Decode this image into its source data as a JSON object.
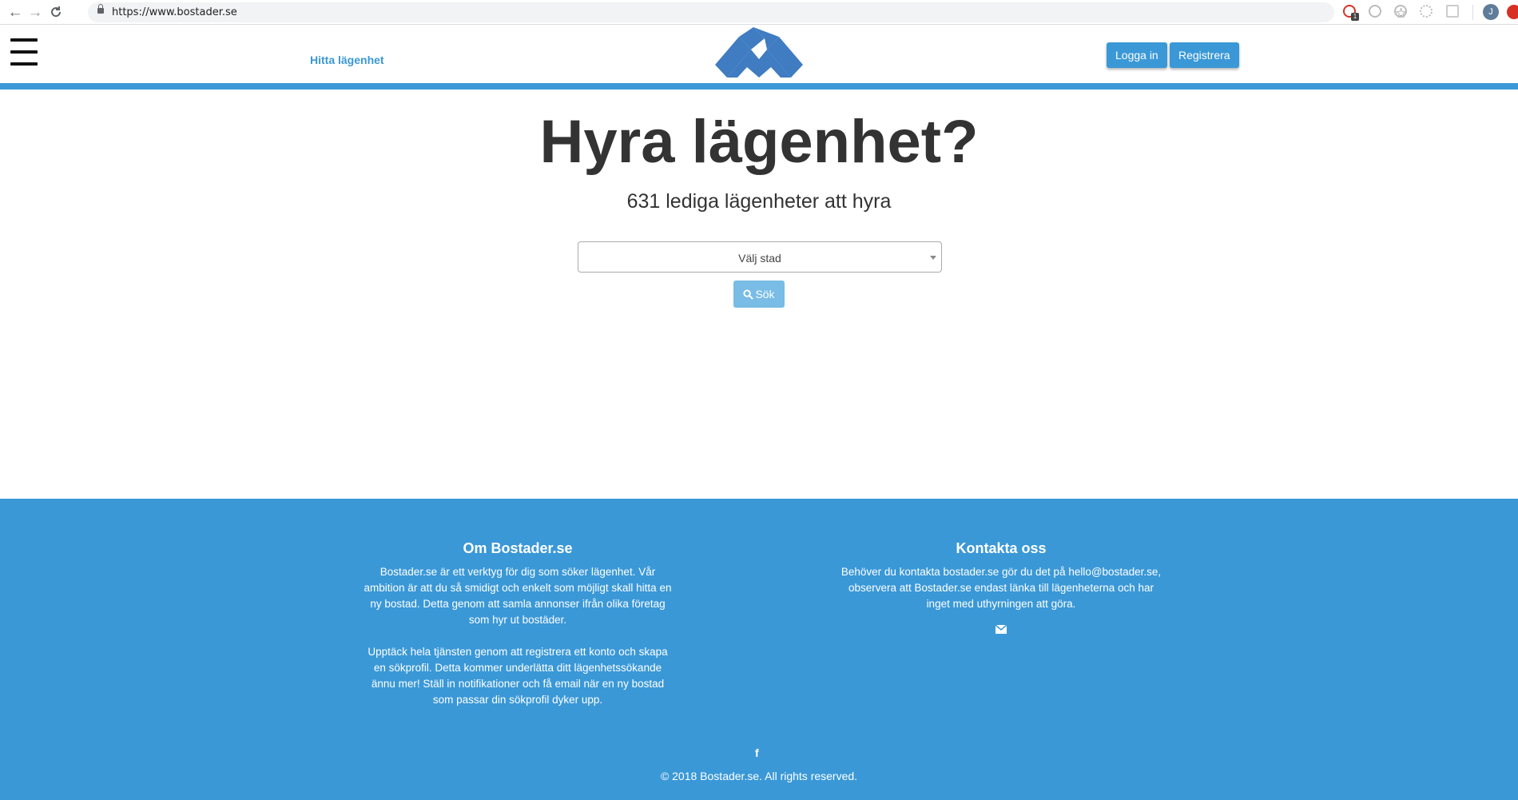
{
  "browser": {
    "url": "https://www.bostader.se",
    "profile_initial": "J",
    "extension_badge": "1"
  },
  "header": {
    "nav_link": "Hitta lägenhet",
    "login_label": "Logga in",
    "register_label": "Registrera"
  },
  "hero": {
    "title": "Hyra lägenhet?",
    "subtitle": "631 lediga lägenheter att hyra",
    "city_select_value": "Välj stad",
    "search_label": "Sök"
  },
  "footer": {
    "about_title": "Om Bostader.se",
    "about_p1": "Bostader.se är ett verktyg för dig som söker lägenhet. Vår ambition är att du så smidigt och enkelt som möjligt skall hitta en ny bostad. Detta genom att samla annonser ifrån olika företag som hyr ut bostäder.",
    "about_p2": "Upptäck hela tjänsten genom att registrera ett konto och skapa en sökprofil. Detta kommer underlätta ditt lägenhetssökande ännu mer! Ställ in notifikationer och få email när en ny bostad som passar din sökprofil dyker upp.",
    "contact_title": "Kontakta oss",
    "contact_text": "Behöver du kontakta bostader.se gör du det på hello@bostader.se, observera att Bostader.se endast länka till lägenheterna och har inget med uthyrningen att göra.",
    "facebook_glyph": "f",
    "copyright": "© 2018 Bostader.se. All rights reserved."
  },
  "colors": {
    "brand_blue": "#3a98d7",
    "search_button": "#79bce6",
    "logo_blue": "#3f7cc1"
  }
}
